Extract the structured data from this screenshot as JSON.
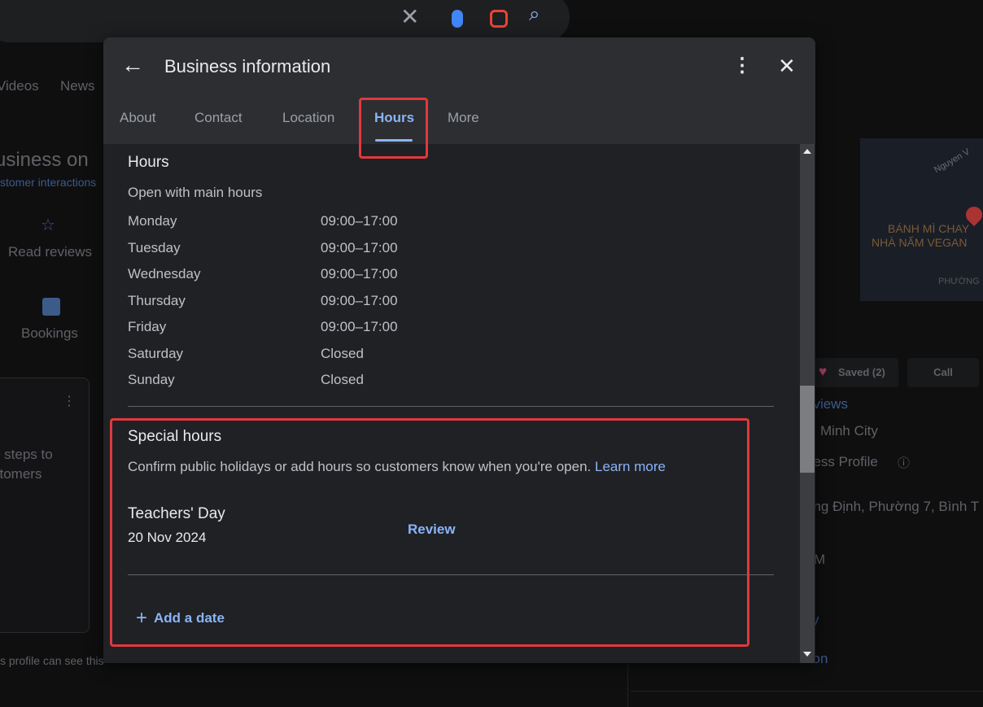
{
  "background": {
    "tabs": [
      "Videos",
      "News"
    ],
    "heading": "usiness on",
    "subheading": "stomer interactions",
    "actions": [
      {
        "label": "Read reviews",
        "icon": "review-star-icon"
      },
      {
        "label": "Bookings",
        "icon": "calendar-icon"
      }
    ],
    "card_text": [
      "e steps to",
      "stomers"
    ],
    "footer_text": "s profile can see this",
    "map_labels": [
      "BÁNH MÌ CHAY",
      "NHÀ NẤM VEGAN",
      "PHƯỜNG",
      "Nguyen V"
    ],
    "saved_label": "Saved (2)",
    "call_label": "Call",
    "right_texts": [
      "eviews",
      "Minh City",
      "ness Profile",
      "ang Định, Phường 7, Bình T",
      "M",
      "y",
      "tion"
    ]
  },
  "dialog": {
    "title": "Business information",
    "tabs": [
      "About",
      "Contact",
      "Location",
      "Hours",
      "More"
    ],
    "active_tab": "Hours",
    "hours": {
      "heading": "Hours",
      "status": "Open with main hours",
      "days": [
        {
          "day": "Monday",
          "time": "09:00–17:00"
        },
        {
          "day": "Tuesday",
          "time": "09:00–17:00"
        },
        {
          "day": "Wednesday",
          "time": "09:00–17:00"
        },
        {
          "day": "Thursday",
          "time": "09:00–17:00"
        },
        {
          "day": "Friday",
          "time": "09:00–17:00"
        },
        {
          "day": "Saturday",
          "time": "Closed"
        },
        {
          "day": "Sunday",
          "time": "Closed"
        }
      ]
    },
    "special": {
      "heading": "Special hours",
      "description": "Confirm public holidays or add hours so customers know when you're open.",
      "learn_more": "Learn more",
      "event_name": "Teachers' Day",
      "event_date": "20 Nov 2024",
      "review_label": "Review",
      "add_date_label": "Add a date"
    }
  },
  "colors": {
    "accent": "#8ab4f8",
    "highlight": "#e0393e"
  }
}
